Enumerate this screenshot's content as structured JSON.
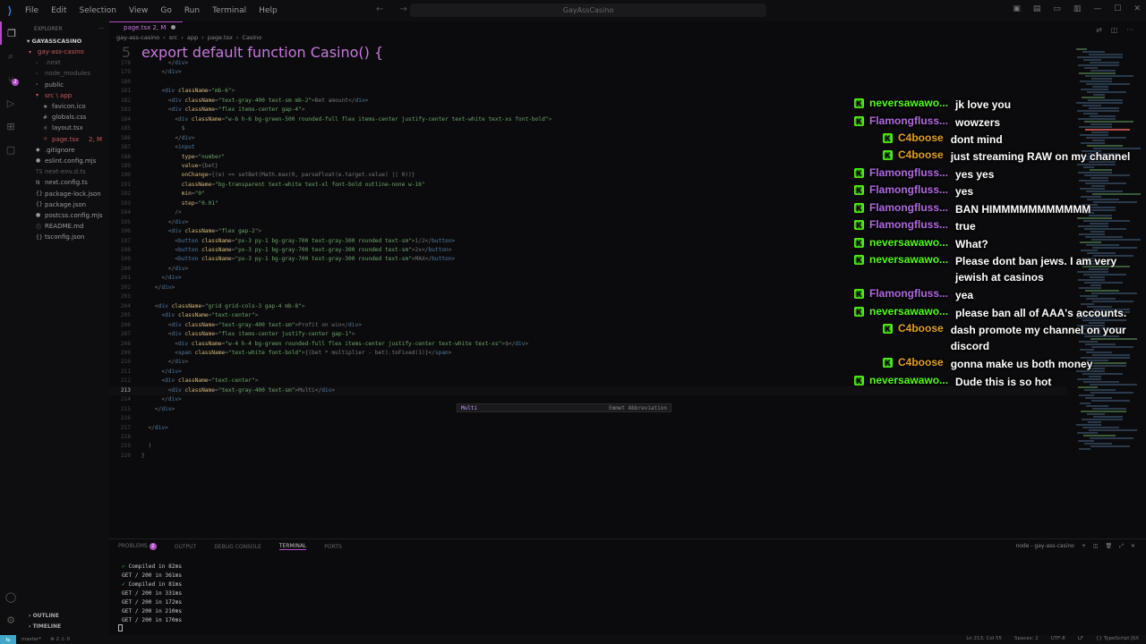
{
  "window": {
    "title": "GayAssCasino"
  },
  "menu": [
    "File",
    "Edit",
    "Selection",
    "View",
    "Go",
    "Run",
    "Terminal",
    "Help"
  ],
  "sidebar": {
    "header": "EXPLORER",
    "root": "GAYASSCASINO",
    "items": [
      {
        "label": "gay-ass-casino",
        "indent": 1,
        "color": "#c45b5b",
        "icon": "▾"
      },
      {
        "label": ".next",
        "indent": 2,
        "color": "#5c5c5c",
        "icon": "›"
      },
      {
        "label": "node_modules",
        "indent": 2,
        "color": "#5c5c5c",
        "icon": "›"
      },
      {
        "label": "public",
        "indent": 2,
        "color": "#9a9a9a",
        "icon": "›"
      },
      {
        "label": "src \\ app",
        "indent": 2,
        "color": "#c45b5b",
        "icon": "▾"
      },
      {
        "label": "favicon.ico",
        "indent": 3,
        "color": "#9a9a9a",
        "icon": "★"
      },
      {
        "label": "globals.css",
        "indent": 3,
        "color": "#9a9a9a",
        "icon": "#"
      },
      {
        "label": "layout.tsx",
        "indent": 3,
        "color": "#9a9a9a",
        "icon": "⚛"
      },
      {
        "label": "page.tsx",
        "indent": 3,
        "color": "#c45b5b",
        "icon": "⚛",
        "badge": "2, M"
      },
      {
        "label": ".gitignore",
        "indent": 2,
        "color": "#9a9a9a",
        "icon": "◆"
      },
      {
        "label": "eslint.config.mjs",
        "indent": 2,
        "color": "#9a9a9a",
        "icon": "●"
      },
      {
        "label": "next-env.d.ts",
        "indent": 2,
        "color": "#5c5c5c",
        "icon": "TS"
      },
      {
        "label": "next.config.ts",
        "indent": 2,
        "color": "#9a9a9a",
        "icon": "N"
      },
      {
        "label": "package-lock.json",
        "indent": 2,
        "color": "#9a9a9a",
        "icon": "{}"
      },
      {
        "label": "package.json",
        "indent": 2,
        "color": "#9a9a9a",
        "icon": "{}"
      },
      {
        "label": "postcss.config.mjs",
        "indent": 2,
        "color": "#9a9a9a",
        "icon": "●"
      },
      {
        "label": "README.md",
        "indent": 2,
        "color": "#9a9a9a",
        "icon": "ⓘ"
      },
      {
        "label": "tsconfig.json",
        "indent": 2,
        "color": "#9a9a9a",
        "icon": "{}"
      }
    ],
    "outline": "OUTLINE",
    "timeline": "TIMELINE"
  },
  "editor": {
    "tab": "page.tsx 2, M",
    "breadcrumb": [
      "gay-ass-casino",
      "src",
      "app",
      "page.tsx",
      "Casino"
    ],
    "sticky": "export default function Casino() {",
    "lines": [
      {
        "n": "178",
        "t": "        </div>"
      },
      {
        "n": "179",
        "t": "      </div>"
      },
      {
        "n": "180",
        "t": ""
      },
      {
        "n": "181",
        "t": "      <div className=\"mb-6\">"
      },
      {
        "n": "182",
        "t": "        <div className=\"text-gray-400 text-sm mb-2\">Bet amount</div>"
      },
      {
        "n": "183",
        "t": "        <div className=\"flex items-center gap-4\">"
      },
      {
        "n": "184",
        "t": "          <div className=\"w-6 h-6 bg-green-500 rounded-full flex items-center justify-center text-white text-xs font-bold\">"
      },
      {
        "n": "185",
        "t": "            $"
      },
      {
        "n": "186",
        "t": "          </div>"
      },
      {
        "n": "187",
        "t": "          <input"
      },
      {
        "n": "188",
        "t": "            type=\"number\""
      },
      {
        "n": "189",
        "t": "            value={bet}"
      },
      {
        "n": "190",
        "t": "            onChange={(e) => setBet(Math.max(0, parseFloat(e.target.value) || 0))}"
      },
      {
        "n": "191",
        "t": "            className=\"bg-transparent text-white text-xl font-bold outline-none w-16\""
      },
      {
        "n": "192",
        "t": "            min=\"0\""
      },
      {
        "n": "193",
        "t": "            step=\"0.01\""
      },
      {
        "n": "194",
        "t": "          />"
      },
      {
        "n": "195",
        "t": "        </div>"
      },
      {
        "n": "196",
        "t": "        <div className=\"flex gap-2\">"
      },
      {
        "n": "197",
        "t": "          <button className=\"px-3 py-1 bg-gray-700 text-gray-300 rounded text-sm\">1/2</button>"
      },
      {
        "n": "198",
        "t": "          <button className=\"px-3 py-1 bg-gray-700 text-gray-300 rounded text-sm\">2x</button>"
      },
      {
        "n": "199",
        "t": "          <button className=\"px-3 py-1 bg-gray-700 text-gray-300 rounded text-sm\">MAX</button>"
      },
      {
        "n": "200",
        "t": "        </div>"
      },
      {
        "n": "201",
        "t": "      </div>"
      },
      {
        "n": "202",
        "t": "    </div>"
      },
      {
        "n": "203",
        "t": ""
      },
      {
        "n": "204",
        "t": "    <div className=\"grid grid-cols-3 gap-4 mb-8\">"
      },
      {
        "n": "205",
        "t": "      <div className=\"text-center\">"
      },
      {
        "n": "206",
        "t": "        <div className=\"text-gray-400 text-sm\">Profit on win</div>"
      },
      {
        "n": "207",
        "t": "        <div className=\"flex items-center justify-center gap-1\">"
      },
      {
        "n": "208",
        "t": "          <div className=\"w-4 h-4 bg-green rounded-full flex items-center justify-center text-white text-xs\">$</div>"
      },
      {
        "n": "209",
        "t": "          <span className=\"text-white font-bold\">{(bet * multiplier - bet).toFixed(1)}</span>"
      },
      {
        "n": "210",
        "t": "        </div>"
      },
      {
        "n": "211",
        "t": "      </div>"
      },
      {
        "n": "212",
        "t": "      <div className=\"text-center\">"
      },
      {
        "n": "213",
        "t": "        <div className=\"text-gray-400 text-sm\">Multi</div>",
        "current": true
      },
      {
        "n": "214",
        "t": "      </div>"
      },
      {
        "n": "215",
        "t": "    </div>"
      },
      {
        "n": "216",
        "t": ""
      },
      {
        "n": "217",
        "t": "  </div>"
      },
      {
        "n": "218",
        "t": ""
      },
      {
        "n": "219",
        "t": "  )"
      },
      {
        "n": "220",
        "t": "}"
      }
    ],
    "autocomplete": {
      "item": "Multi",
      "description": "Emmet Abbreviation"
    }
  },
  "chat": [
    {
      "user": "neversawawo...",
      "color": "#53fc18",
      "text": "jk love you",
      "indent": false
    },
    {
      "user": "Flamongfluss...",
      "color": "#b06ae0",
      "text": "wowzers",
      "indent": false
    },
    {
      "user": "C4boose",
      "color": "#e0a020",
      "text": "dont mind",
      "indent": true
    },
    {
      "user": "C4boose",
      "color": "#e0a020",
      "text": "just streaming RAW on my channel",
      "indent": true
    },
    {
      "user": "Flamongfluss...",
      "color": "#b06ae0",
      "text": "yes yes",
      "indent": false
    },
    {
      "user": "Flamongfluss...",
      "color": "#b06ae0",
      "text": "yes",
      "indent": false
    },
    {
      "user": "Flamongfluss...",
      "color": "#b06ae0",
      "text": "BAN HIMMMMMMMMMMM",
      "indent": false
    },
    {
      "user": "Flamongfluss...",
      "color": "#b06ae0",
      "text": "true",
      "indent": false
    },
    {
      "user": "neversawawo...",
      "color": "#53fc18",
      "text": "What?",
      "indent": false
    },
    {
      "user": "neversawawo...",
      "color": "#53fc18",
      "text": "Please dont ban jews. I am very jewish at casinos",
      "indent": false
    },
    {
      "user": "Flamongfluss...",
      "color": "#b06ae0",
      "text": "yea",
      "indent": false
    },
    {
      "user": "neversawawo...",
      "color": "#53fc18",
      "text": "please ban all of AAA's accounts.",
      "indent": false
    },
    {
      "user": "C4boose",
      "color": "#e0a020",
      "text": "dash promote my channel on your discord",
      "indent": true
    },
    {
      "user": "C4boose",
      "color": "#e0a020",
      "text": "gonna make us both money",
      "indent": true
    },
    {
      "user": "neversawawo...",
      "color": "#53fc18",
      "text": "Dude this is so hot",
      "indent": false
    }
  ],
  "panel": {
    "tabs": [
      "PROBLEMS",
      "OUTPUT",
      "DEBUG CONSOLE",
      "TERMINAL",
      "PORTS"
    ],
    "problems_count": "2",
    "active_tab": "TERMINAL",
    "terminal_name": "node - gay-ass-casino",
    "terminal": [
      {
        "check": true,
        "text": "Compiled in 82ms"
      },
      {
        "check": false,
        "text": "GET / 200 in 361ms"
      },
      {
        "check": true,
        "text": "Compiled in 81ms"
      },
      {
        "check": false,
        "text": "GET / 200 in 331ms"
      },
      {
        "check": false,
        "text": "GET / 200 in 172ms"
      },
      {
        "check": false,
        "text": "GET / 200 in 210ms"
      },
      {
        "check": false,
        "text": "GET / 200 in 170ms"
      }
    ]
  },
  "status": {
    "branch": "master*",
    "errors": "⊗ 2 ⚠ 0",
    "right": [
      "Ln 213, Col 55",
      "Spaces: 2",
      "UTF-8",
      "LF",
      "{} TypeScript JSX"
    ]
  }
}
